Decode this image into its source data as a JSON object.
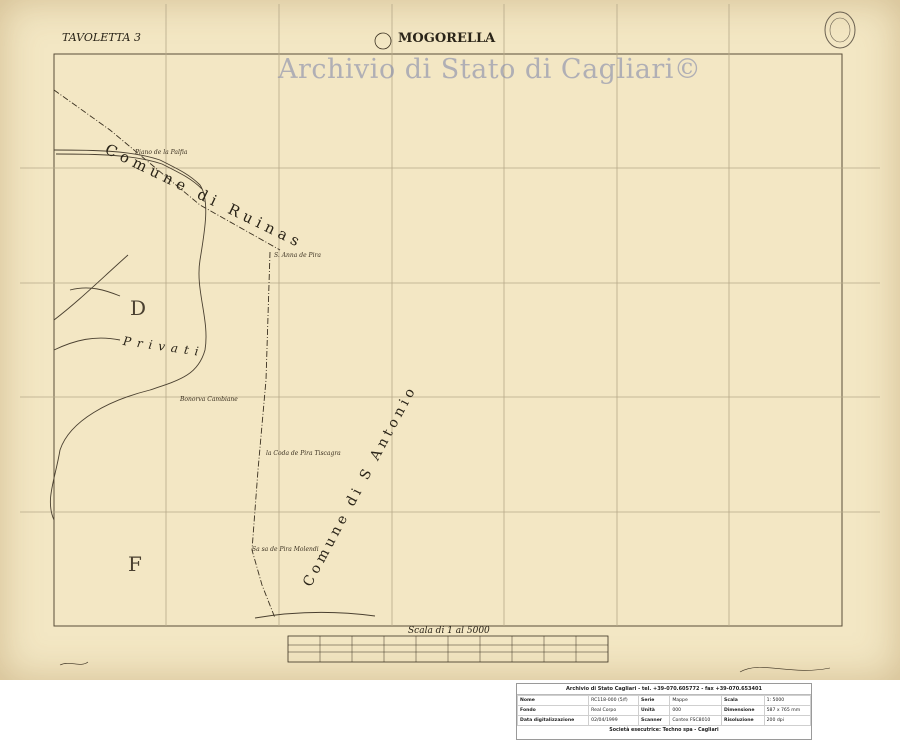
{
  "sheet": {
    "tavoletta": "TAVOLETTA 3",
    "title": "MOGORELLA",
    "watermark": "Archivio di Stato di Cagliari©",
    "scale_label": "Scala di 1 al 5000"
  },
  "labels": {
    "comune_ruinas": "Comune di Ruinas",
    "privati": "Privati",
    "comune_santonio": "Comune di S Antonio",
    "letter_d": "D",
    "letter_f": "F",
    "place_1": "Piano de la Palfia",
    "place_2": "S. Anna de Pira",
    "place_3": "Bonorva Cambiane",
    "place_4": "la Coda de Pira Tiscagra",
    "place_5": "Sa sa de Pira Molendi"
  },
  "info": {
    "header": "Archivio di Stato Cagliari - tel. +39-070.605772 - fax +39-070.653401",
    "rows": [
      [
        "Nome",
        "RC118-000 (5/f)",
        "Serie",
        "Mappe",
        "Scala",
        "1: 5000"
      ],
      [
        "Fondo",
        "Real Corpo",
        "Unità",
        "000",
        "Dimensione",
        "587 x 765 mm"
      ],
      [
        "Data digitalizzazione",
        "02/04/1999",
        "Scanner",
        "Contex FSC8010",
        "Risoluzione",
        "200 dpi"
      ]
    ],
    "footer": "Società esecutrice: Techno spa - Cagliari"
  },
  "colors": {
    "paper": "#f3e7c4",
    "ink": "#2a2418",
    "grid": "#b6a98a"
  }
}
